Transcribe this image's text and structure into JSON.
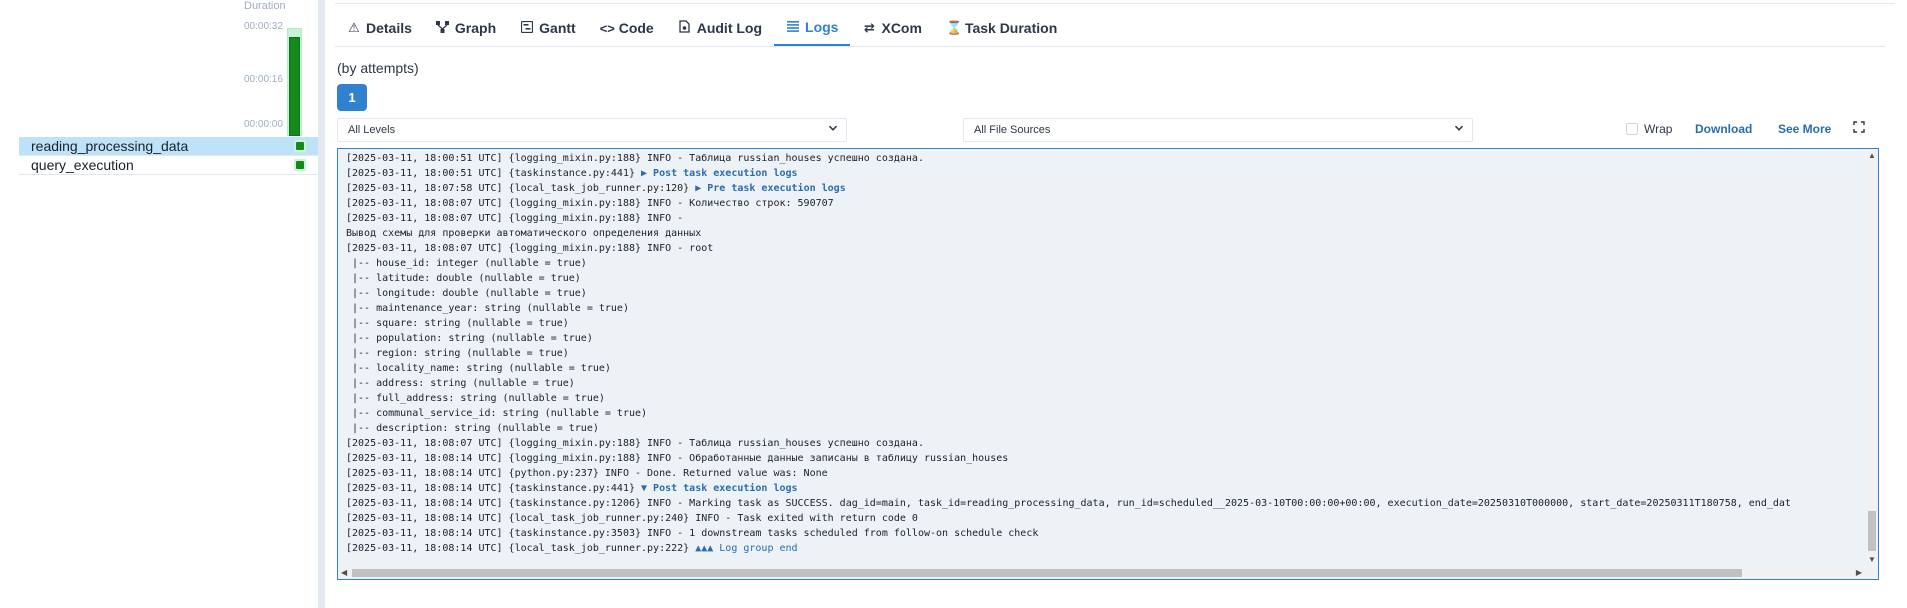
{
  "grid": {
    "duration_header": "Duration",
    "ticks": [
      "00:00:32",
      "00:00:16",
      "00:00:00"
    ],
    "run_duration_fraction": 0.95,
    "tasks": [
      {
        "name": "reading_processing_data",
        "selected": true
      },
      {
        "name": "query_execution",
        "selected": false
      }
    ]
  },
  "tabs": [
    {
      "label": "Details",
      "icon": "warning-icon",
      "active": false
    },
    {
      "label": "Graph",
      "icon": "graph-icon",
      "active": false
    },
    {
      "label": "Gantt",
      "icon": "gantt-icon",
      "active": false
    },
    {
      "label": "Code",
      "icon": "code-icon",
      "active": false
    },
    {
      "label": "Audit Log",
      "icon": "audit-log-icon",
      "active": false
    },
    {
      "label": "Logs",
      "icon": "logs-icon",
      "active": true
    },
    {
      "label": "XCom",
      "icon": "xcom-icon",
      "active": false
    },
    {
      "label": "Task Duration",
      "icon": "hourglass-icon",
      "active": false
    }
  ],
  "logs": {
    "attempts_label": "(by attempts)",
    "attempt_number": "1",
    "level_select": "All Levels",
    "source_select": "All File Sources",
    "wrap_label": "Wrap",
    "wrap_checked": false,
    "download_label": "Download",
    "see_more_label": "See More",
    "lines": [
      {
        "text": "[2025-03-11, 18:00:51 UTC] {logging_mixin.py:188} INFO - Таблица russian_houses успешно создана."
      },
      {
        "text": "[2025-03-11, 18:00:51 UTC] {taskinstance.py:441} ",
        "link": "▶ Post task execution logs"
      },
      {
        "text": "[2025-03-11, 18:07:58 UTC] {local_task_job_runner.py:120} ",
        "link": "▶ Pre task execution logs"
      },
      {
        "text": "[2025-03-11, 18:08:07 UTC] {logging_mixin.py:188} INFO - Количество строк: 590707"
      },
      {
        "text": "[2025-03-11, 18:08:07 UTC] {logging_mixin.py:188} INFO -"
      },
      {
        "text": "Вывод схемы для проверки автоматического определения данных"
      },
      {
        "text": "[2025-03-11, 18:08:07 UTC] {logging_mixin.py:188} INFO - root"
      },
      {
        "text": " |-- house_id: integer (nullable = true)"
      },
      {
        "text": " |-- latitude: double (nullable = true)"
      },
      {
        "text": " |-- longitude: double (nullable = true)"
      },
      {
        "text": " |-- maintenance_year: string (nullable = true)"
      },
      {
        "text": " |-- square: string (nullable = true)"
      },
      {
        "text": " |-- population: string (nullable = true)"
      },
      {
        "text": " |-- region: string (nullable = true)"
      },
      {
        "text": " |-- locality_name: string (nullable = true)"
      },
      {
        "text": " |-- address: string (nullable = true)"
      },
      {
        "text": " |-- full_address: string (nullable = true)"
      },
      {
        "text": " |-- communal_service_id: string (nullable = true)"
      },
      {
        "text": " |-- description: string (nullable = true)"
      },
      {
        "text": "[2025-03-11, 18:08:07 UTC] {logging_mixin.py:188} INFO - Таблица russian_houses успешно создана."
      },
      {
        "text": "[2025-03-11, 18:08:14 UTC] {logging_mixin.py:188} INFO - Обработанные данные записаны в таблицу russian_houses"
      },
      {
        "text": "[2025-03-11, 18:08:14 UTC] {python.py:237} INFO - Done. Returned value was: None"
      },
      {
        "text": "[2025-03-11, 18:08:14 UTC] {taskinstance.py:441} ",
        "link": "▼ Post task execution logs"
      },
      {
        "text": "[2025-03-11, 18:08:14 UTC] {taskinstance.py:1206} INFO - Marking task as SUCCESS. dag_id=main, task_id=reading_processing_data, run_id=scheduled__2025-03-10T00:00:00+00:00, execution_date=20250310T000000, start_date=20250311T180758, end_dat"
      },
      {
        "text": "[2025-03-11, 18:08:14 UTC] {local_task_job_runner.py:240} INFO - Task exited with return code 0"
      },
      {
        "text": "[2025-03-11, 18:08:14 UTC] {taskinstance.py:3503} INFO - 1 downstream tasks scheduled from follow-on schedule check"
      },
      {
        "text": "[2025-03-11, 18:08:14 UTC] {local_task_job_runner.py:222} ",
        "link": "▲▲▲ Log group end",
        "plain_link": true
      }
    ]
  },
  "colors": {
    "accent": "#3182ce",
    "success": "#15891c",
    "selected_row": "#bee3f8",
    "log_bg": "#edf2f7"
  }
}
